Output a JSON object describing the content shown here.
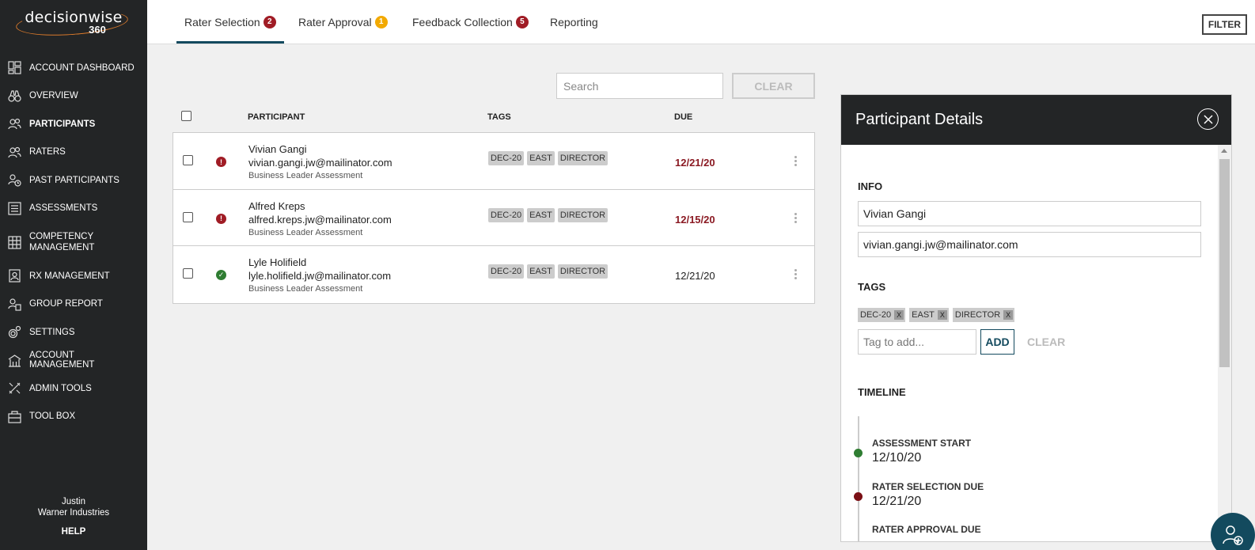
{
  "brand": {
    "name": "decisionwise",
    "sub": "360"
  },
  "sidebar": {
    "items": [
      {
        "label": "ACCOUNT DASHBOARD",
        "icon": "dashboard-icon"
      },
      {
        "label": "OVERVIEW",
        "icon": "binoculars-icon"
      },
      {
        "label": "PARTICIPANTS",
        "icon": "users-icon"
      },
      {
        "label": "RATERS",
        "icon": "users-icon"
      },
      {
        "label": "PAST PARTICIPANTS",
        "icon": "users-clock-icon"
      },
      {
        "label": "ASSESSMENTS",
        "icon": "list-icon"
      },
      {
        "label": "COMPETENCY MANAGEMENT",
        "icon": "grid-icon"
      },
      {
        "label": "RX MANAGEMENT",
        "icon": "user-doc-icon"
      },
      {
        "label": "GROUP REPORT",
        "icon": "group-report-icon"
      },
      {
        "label": "SETTINGS",
        "icon": "gear-icon"
      },
      {
        "label": "ACCOUNT MANAGEMENT",
        "icon": "building-icon"
      },
      {
        "label": "ADMIN TOOLS",
        "icon": "tools-icon"
      },
      {
        "label": "TOOL BOX",
        "icon": "toolbox-icon"
      }
    ],
    "user": {
      "name": "Justin",
      "company": "Warner Industries"
    },
    "help_label": "HELP"
  },
  "tabs": [
    {
      "label": "Rater Selection",
      "badge": "2"
    },
    {
      "label": "Rater Approval",
      "badge": "1"
    },
    {
      "label": "Feedback Collection",
      "badge": "5"
    },
    {
      "label": "Reporting"
    }
  ],
  "filter_label": "FILTER",
  "search": {
    "placeholder": "Search",
    "clear_label": "CLEAR"
  },
  "table": {
    "headers": {
      "participant": "PARTICIPANT",
      "tags": "TAGS",
      "due": "DUE"
    },
    "rows": [
      {
        "name": "Vivian Gangi",
        "email": "vivian.gangi.jw@mailinator.com",
        "assessment": "Business Leader Assessment",
        "tags": [
          "DEC-20",
          "EAST",
          "DIRECTOR"
        ],
        "due": "12/21/20",
        "status": "alert"
      },
      {
        "name": "Alfred Kreps",
        "email": "alfred.kreps.jw@mailinator.com",
        "assessment": "Business Leader Assessment",
        "tags": [
          "DEC-20",
          "EAST",
          "DIRECTOR"
        ],
        "due": "12/15/20",
        "status": "alert"
      },
      {
        "name": "Lyle Holifield",
        "email": "lyle.holifield.jw@mailinator.com",
        "assessment": "Business Leader Assessment",
        "tags": [
          "DEC-20",
          "EAST",
          "DIRECTOR"
        ],
        "due": "12/21/20",
        "status": "ok"
      }
    ]
  },
  "panel": {
    "title": "Participant Details",
    "info_title": "INFO",
    "name": "Vivian Gangi",
    "email": "vivian.gangi.jw@mailinator.com",
    "tags_title": "TAGS",
    "tags": [
      "DEC-20",
      "EAST",
      "DIRECTOR"
    ],
    "tag_remove": "X",
    "tag_placeholder": "Tag to add...",
    "add_label": "ADD",
    "clear_label": "CLEAR",
    "timeline_title": "TIMELINE",
    "timeline": [
      {
        "label": "ASSESSMENT START",
        "date": "12/10/20",
        "color": "#2f7d32"
      },
      {
        "label": "RATER SELECTION DUE",
        "date": "12/21/20",
        "color": "#7a0f15"
      },
      {
        "label": "RATER APPROVAL DUE",
        "date": ""
      }
    ]
  },
  "colors": {
    "accent": "#134a5e",
    "alert": "#a01c25",
    "ok": "#2f7d32",
    "sidebar": "#232526"
  }
}
